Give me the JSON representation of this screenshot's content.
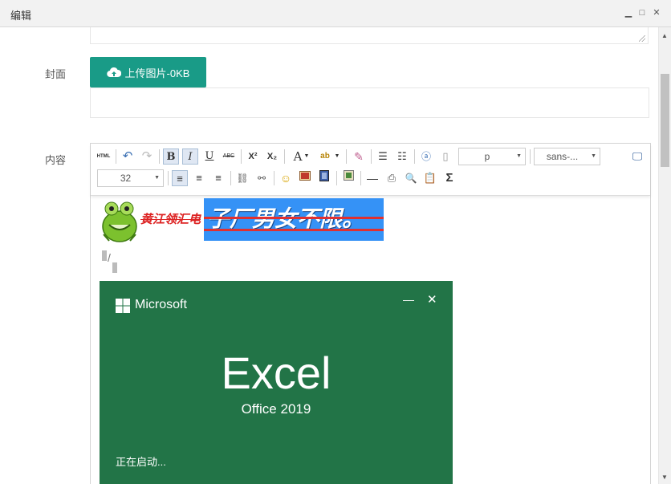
{
  "dialog": {
    "title": "编辑",
    "min_icon": "minimize-icon",
    "max_icon": "maximize-icon"
  },
  "form": {
    "cover_label": "封面",
    "upload_button": "上传图片-0KB",
    "content_label": "内容"
  },
  "toolbar": {
    "html_label": "HTML",
    "bold": "B",
    "italic": "I",
    "underline": "U",
    "strike": "ABC",
    "superscript": "X²",
    "subscript": "X₂",
    "font_color": "A",
    "paragraph": "p",
    "font_family": "sans-...",
    "font_size": "32",
    "sigma": "Σ"
  },
  "editor_content": {
    "red_text": "黄江领汇电",
    "highlight_text": "子厂男女不限。"
  },
  "excel_splash": {
    "brand": "Microsoft",
    "app": "Excel",
    "version": "Office 2019",
    "status": "正在启动..."
  },
  "colors": {
    "accent": "#199b87",
    "excel_green": "#227447",
    "highlight_blue": "#3592f6",
    "red": "#d22222"
  }
}
